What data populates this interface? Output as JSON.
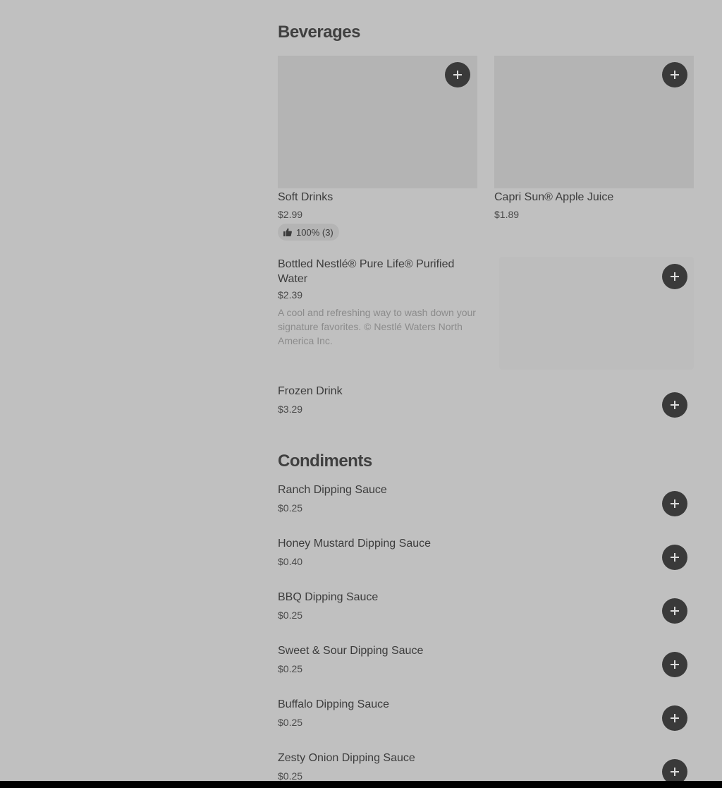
{
  "beverages": {
    "title": "Beverages",
    "cards": [
      {
        "name": "Soft Drinks",
        "price": "$2.99",
        "rating": "100% (3)"
      },
      {
        "name": "Capri Sun® Apple Juice",
        "price": "$1.89"
      }
    ],
    "water": {
      "name": "Bottled Nestlé® Pure Life® Purified Water",
      "price": "$2.39",
      "description": "A cool and refreshing way to wash down your signature favorites. © Nestlé Waters North America Inc."
    },
    "frozen": {
      "name": "Frozen Drink",
      "price": "$3.29"
    }
  },
  "condiments": {
    "title": "Condiments",
    "items": [
      {
        "name": "Ranch Dipping Sauce",
        "price": "$0.25"
      },
      {
        "name": "Honey Mustard Dipping Sauce",
        "price": "$0.40"
      },
      {
        "name": "BBQ Dipping Sauce",
        "price": "$0.25"
      },
      {
        "name": "Sweet & Sour Dipping Sauce",
        "price": "$0.25"
      },
      {
        "name": "Buffalo Dipping Sauce",
        "price": "$0.25"
      },
      {
        "name": "Zesty Onion Dipping Sauce",
        "price": "$0.25"
      }
    ]
  },
  "icons": {
    "add": "plus-icon",
    "rating": "thumbs-up-icon"
  },
  "colors": {
    "background": "#c0c0c0",
    "button": "#3a3a3a",
    "image_placeholder": "#b4b4b4"
  }
}
